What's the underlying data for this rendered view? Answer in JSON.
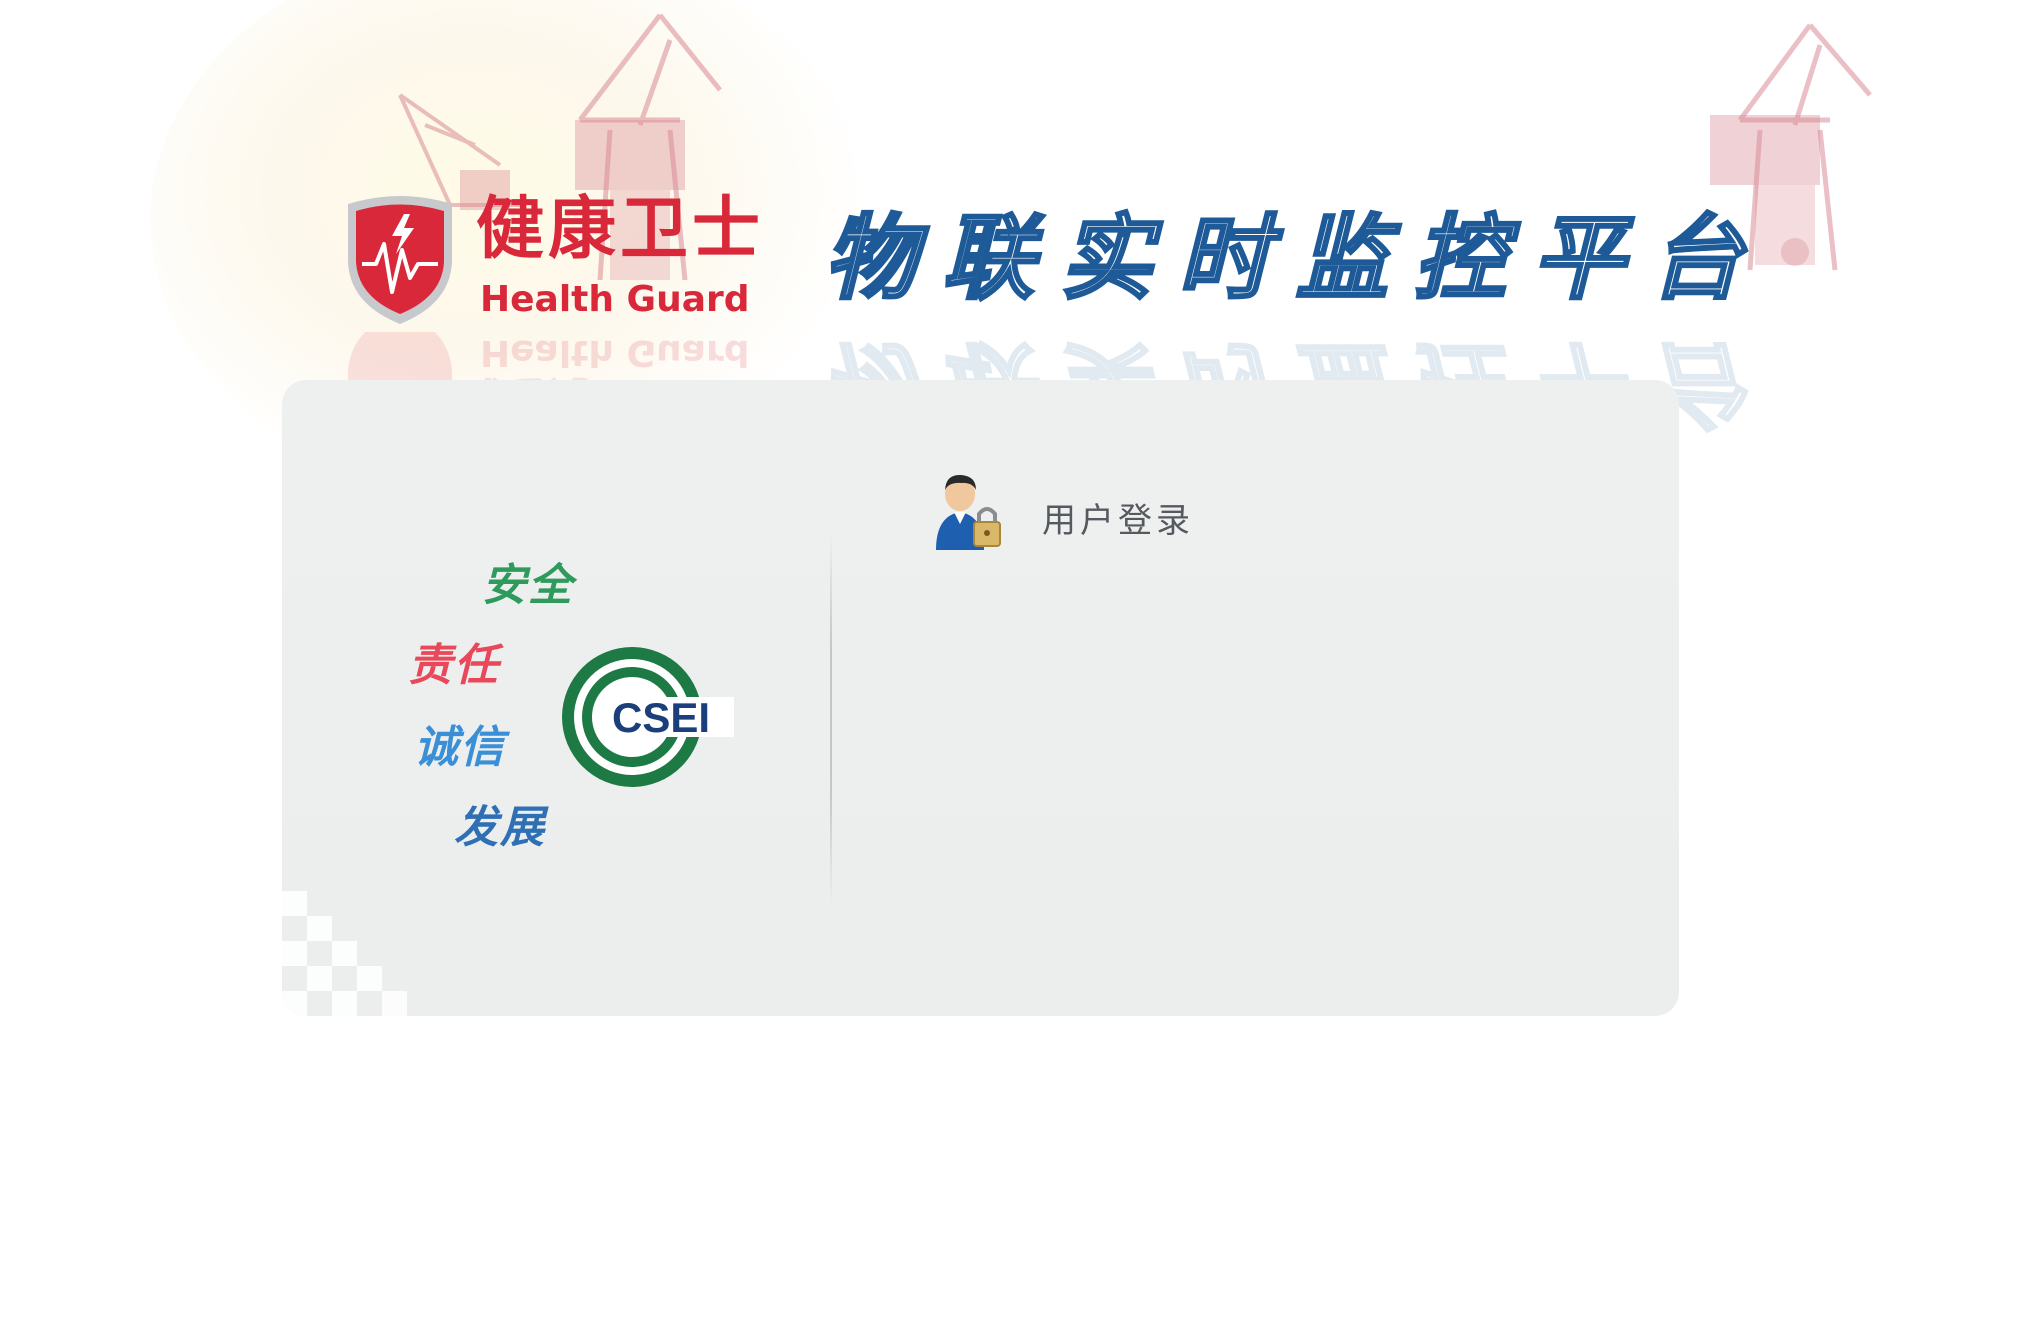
{
  "brand": {
    "name_cn": "健康卫士",
    "name_en": "Health Guard",
    "color": "#d8283a"
  },
  "platform": {
    "title": "物联实时监控平台",
    "stroke_color": "#1e5a98"
  },
  "slogans": [
    {
      "text": "安全",
      "color": "#2e9a5c"
    },
    {
      "text": "责任",
      "color": "#e8485a"
    },
    {
      "text": "诚信",
      "color": "#3a8fd6"
    },
    {
      "text": "发展",
      "color": "#2f6fb3"
    }
  ],
  "csei": {
    "text": "CSEI",
    "ring_color": "#1e7a44",
    "text_color": "#1a3f7a"
  },
  "login": {
    "title": "用户登录",
    "icon": "user-lock-icon"
  },
  "decor": {
    "crane_color": "#d98c96"
  }
}
